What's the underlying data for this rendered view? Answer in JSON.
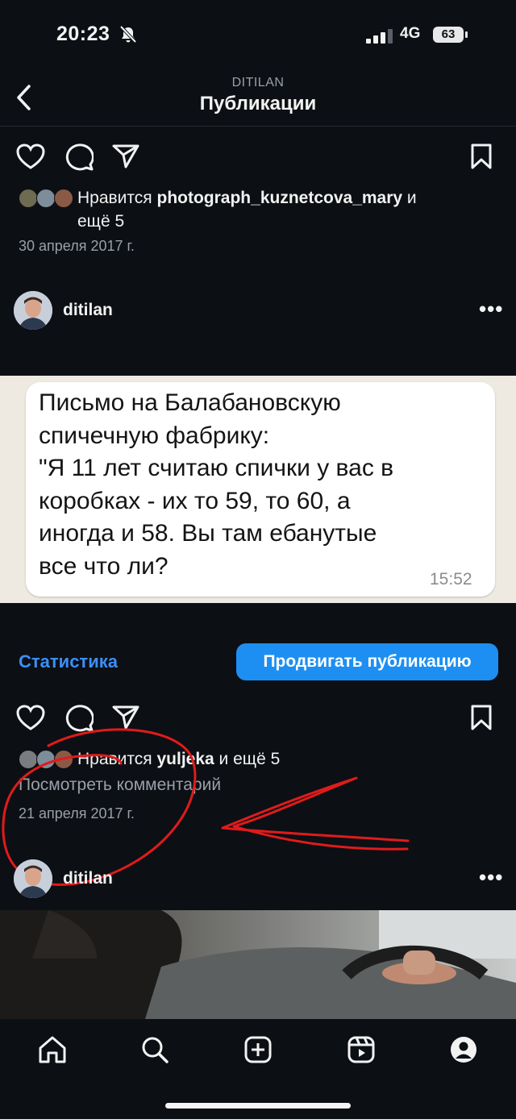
{
  "status": {
    "time": "20:23",
    "network": "4G",
    "battery": "63"
  },
  "header": {
    "account": "DITILAN",
    "title": "Публикации"
  },
  "post1_footer": {
    "likes_prefix": "Нравится ",
    "likes_user": "photograph_kuznetcova_mary",
    "likes_suffix": " и",
    "likes_more": "ещё 5",
    "date": "30 апреля 2017 г."
  },
  "post2": {
    "username": "ditilan",
    "more": "•••",
    "message_text": "Письмо на Балабановскую\nспичечную фабрику:\n\"Я 11 лет считаю спички у вас в\nкоробках - их то 59, то 60, а\nиногда и 58. Вы там ебанутые\nвсе что ли?",
    "message_time": "15:52",
    "stats_label": "Статистика",
    "promote_label": "Продвигать публикацию",
    "likes_prefix": "Нравится ",
    "likes_user": "yuljeka",
    "likes_suffix": " и ещё 5",
    "view_comment": "Посмотреть комментарий",
    "date": "21 апреля 2017 г."
  },
  "post3": {
    "username": "ditilan",
    "more": "•••"
  },
  "colors": {
    "accent": "#1d8ff2",
    "link": "#3b8ff7",
    "annotation": "#e01b1b",
    "background": "#0c0f14"
  },
  "nav_icons": [
    "home-icon",
    "search-icon",
    "create-icon",
    "reels-icon",
    "profile-icon"
  ]
}
